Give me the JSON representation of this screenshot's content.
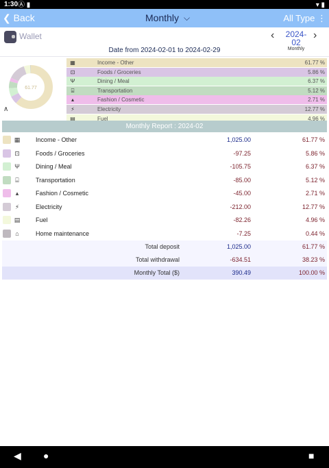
{
  "status": {
    "time": "1:30",
    "icons": "Ⓐ ▮",
    "right": "▾ ▮"
  },
  "header": {
    "back_label": "Back",
    "title": "Monthly",
    "type_label": "All Type"
  },
  "wallet": {
    "label": "Wallet",
    "month": "2024-02",
    "month_sub": "Monthly"
  },
  "date_range": "Date from 2024-02-01 to 2024-02-29",
  "donut": {
    "center_label": "61.77"
  },
  "legend": [
    {
      "icon": "credit-card-icon",
      "glyph": "▦",
      "name": "Income - Other",
      "pct": "61.77 %",
      "color": "#ede3c1"
    },
    {
      "icon": "cart-icon",
      "glyph": "⊡",
      "name": "Foods / Groceries",
      "pct": "5.86 %",
      "color": "#d9c5e5"
    },
    {
      "icon": "fork-knife-icon",
      "glyph": "Ψ",
      "name": "Dining / Meal",
      "pct": "6.37 %",
      "color": "#d2f0d2"
    },
    {
      "icon": "bus-icon",
      "glyph": "⌸",
      "name": "Transportation",
      "pct": "5.12 %",
      "color": "#c1dcc1"
    },
    {
      "icon": "shirt-icon",
      "glyph": "▴",
      "name": "Fashion / Cosmetic",
      "pct": "2.71 %",
      "color": "#efbdea"
    },
    {
      "icon": "plug-icon",
      "glyph": "⚡",
      "name": "Electricity",
      "pct": "12.77 %",
      "color": "#d4cbd6"
    },
    {
      "icon": "fuel-icon",
      "glyph": "▤",
      "name": "Fuel",
      "pct": "4.96 %",
      "color": "#f3f8dc"
    }
  ],
  "report": {
    "title": "Monthly Report : 2024-02",
    "rows": [
      {
        "icon": "credit-card-icon",
        "glyph": "▦",
        "color": "#ede3c1",
        "name": "Income - Other",
        "amount": "1,025.00",
        "pct": "61.77 %",
        "positive": true
      },
      {
        "icon": "cart-icon",
        "glyph": "⊡",
        "color": "#d9c5e5",
        "name": "Foods / Groceries",
        "amount": "-97.25",
        "pct": "5.86 %"
      },
      {
        "icon": "fork-knife-icon",
        "glyph": "Ψ",
        "color": "#d2f0d2",
        "name": "Dining / Meal",
        "amount": "-105.75",
        "pct": "6.37 %"
      },
      {
        "icon": "bus-icon",
        "glyph": "⌸",
        "color": "#c1dcc1",
        "name": "Transportation",
        "amount": "-85.00",
        "pct": "5.12 %"
      },
      {
        "icon": "shirt-icon",
        "glyph": "▴",
        "color": "#efbdea",
        "name": "Fashion / Cosmetic",
        "amount": "-45.00",
        "pct": "2.71 %"
      },
      {
        "icon": "plug-icon",
        "glyph": "⚡",
        "color": "#d4cbd6",
        "name": "Electricity",
        "amount": "-212.00",
        "pct": "12.77 %"
      },
      {
        "icon": "fuel-icon",
        "glyph": "▤",
        "color": "#f3f8dc",
        "name": "Fuel",
        "amount": "-82.26",
        "pct": "4.96 %"
      },
      {
        "icon": "home-icon",
        "glyph": "⌂",
        "color": "#bfb9bf",
        "name": "Home maintenance",
        "amount": "-7.25",
        "pct": "0.44 %"
      }
    ],
    "total_deposit": {
      "label": "Total deposit",
      "amount": "1,025.00",
      "pct": "61.77 %"
    },
    "total_withdrawal": {
      "label": "Total withdrawal",
      "amount": "-634.51",
      "pct": "38.23 %"
    },
    "monthly_total": {
      "label": "Monthly Total ($)",
      "amount": "390.49",
      "pct": "100.00 %"
    }
  }
}
